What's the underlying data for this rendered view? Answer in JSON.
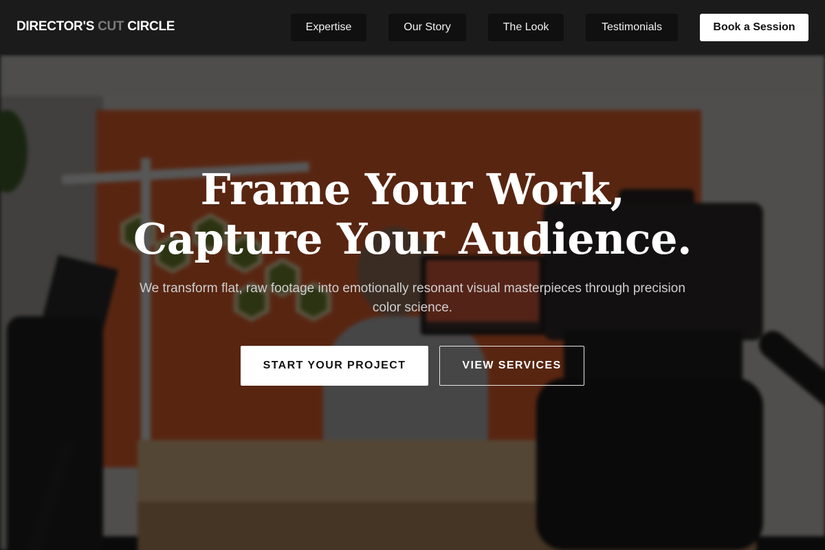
{
  "brand": {
    "name_part1": "DIRECTOR'S",
    "name_part2": "CUT",
    "name_part3": "CIRCLE"
  },
  "nav": {
    "items": [
      {
        "label": "Expertise"
      },
      {
        "label": "Our Story"
      },
      {
        "label": "The Look"
      },
      {
        "label": "Testimonials"
      }
    ],
    "cta_label": "Book a Session"
  },
  "hero": {
    "headline_line1": "Frame Your Work,",
    "headline_line2": "Capture Your Audience.",
    "subtext": "We transform flat, raw footage into emotionally resonant visual masterpieces through precision color science.",
    "primary_cta": "START YOUR PROJECT",
    "secondary_cta": "VIEW SERVICES"
  },
  "colors": {
    "header_bg": "#1b1b1b",
    "nav_button_bg": "#101010",
    "cta_bg": "#ffffff",
    "accent_wall": "#d15a2a"
  }
}
